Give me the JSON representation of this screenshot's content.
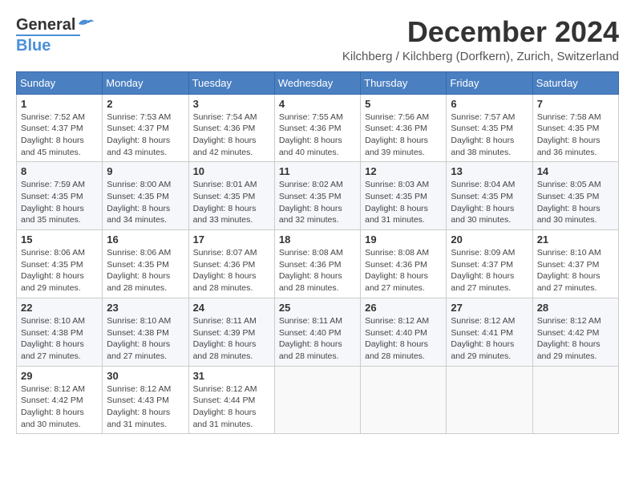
{
  "header": {
    "logo": {
      "line1": "General",
      "line2": "Blue",
      "bird": "🐦"
    },
    "title": "December 2024",
    "location": "Kilchberg / Kilchberg (Dorfkern), Zurich, Switzerland"
  },
  "weekdays": [
    "Sunday",
    "Monday",
    "Tuesday",
    "Wednesday",
    "Thursday",
    "Friday",
    "Saturday"
  ],
  "weeks": [
    [
      {
        "day": "1",
        "sunrise": "7:52 AM",
        "sunset": "4:37 PM",
        "daylight": "8 hours and 45 minutes."
      },
      {
        "day": "2",
        "sunrise": "7:53 AM",
        "sunset": "4:37 PM",
        "daylight": "8 hours and 43 minutes."
      },
      {
        "day": "3",
        "sunrise": "7:54 AM",
        "sunset": "4:36 PM",
        "daylight": "8 hours and 42 minutes."
      },
      {
        "day": "4",
        "sunrise": "7:55 AM",
        "sunset": "4:36 PM",
        "daylight": "8 hours and 40 minutes."
      },
      {
        "day": "5",
        "sunrise": "7:56 AM",
        "sunset": "4:36 PM",
        "daylight": "8 hours and 39 minutes."
      },
      {
        "day": "6",
        "sunrise": "7:57 AM",
        "sunset": "4:35 PM",
        "daylight": "8 hours and 38 minutes."
      },
      {
        "day": "7",
        "sunrise": "7:58 AM",
        "sunset": "4:35 PM",
        "daylight": "8 hours and 36 minutes."
      }
    ],
    [
      {
        "day": "8",
        "sunrise": "7:59 AM",
        "sunset": "4:35 PM",
        "daylight": "8 hours and 35 minutes."
      },
      {
        "day": "9",
        "sunrise": "8:00 AM",
        "sunset": "4:35 PM",
        "daylight": "8 hours and 34 minutes."
      },
      {
        "day": "10",
        "sunrise": "8:01 AM",
        "sunset": "4:35 PM",
        "daylight": "8 hours and 33 minutes."
      },
      {
        "day": "11",
        "sunrise": "8:02 AM",
        "sunset": "4:35 PM",
        "daylight": "8 hours and 32 minutes."
      },
      {
        "day": "12",
        "sunrise": "8:03 AM",
        "sunset": "4:35 PM",
        "daylight": "8 hours and 31 minutes."
      },
      {
        "day": "13",
        "sunrise": "8:04 AM",
        "sunset": "4:35 PM",
        "daylight": "8 hours and 30 minutes."
      },
      {
        "day": "14",
        "sunrise": "8:05 AM",
        "sunset": "4:35 PM",
        "daylight": "8 hours and 30 minutes."
      }
    ],
    [
      {
        "day": "15",
        "sunrise": "8:06 AM",
        "sunset": "4:35 PM",
        "daylight": "8 hours and 29 minutes."
      },
      {
        "day": "16",
        "sunrise": "8:06 AM",
        "sunset": "4:35 PM",
        "daylight": "8 hours and 28 minutes."
      },
      {
        "day": "17",
        "sunrise": "8:07 AM",
        "sunset": "4:36 PM",
        "daylight": "8 hours and 28 minutes."
      },
      {
        "day": "18",
        "sunrise": "8:08 AM",
        "sunset": "4:36 PM",
        "daylight": "8 hours and 28 minutes."
      },
      {
        "day": "19",
        "sunrise": "8:08 AM",
        "sunset": "4:36 PM",
        "daylight": "8 hours and 27 minutes."
      },
      {
        "day": "20",
        "sunrise": "8:09 AM",
        "sunset": "4:37 PM",
        "daylight": "8 hours and 27 minutes."
      },
      {
        "day": "21",
        "sunrise": "8:10 AM",
        "sunset": "4:37 PM",
        "daylight": "8 hours and 27 minutes."
      }
    ],
    [
      {
        "day": "22",
        "sunrise": "8:10 AM",
        "sunset": "4:38 PM",
        "daylight": "8 hours and 27 minutes."
      },
      {
        "day": "23",
        "sunrise": "8:10 AM",
        "sunset": "4:38 PM",
        "daylight": "8 hours and 27 minutes."
      },
      {
        "day": "24",
        "sunrise": "8:11 AM",
        "sunset": "4:39 PM",
        "daylight": "8 hours and 28 minutes."
      },
      {
        "day": "25",
        "sunrise": "8:11 AM",
        "sunset": "4:40 PM",
        "daylight": "8 hours and 28 minutes."
      },
      {
        "day": "26",
        "sunrise": "8:12 AM",
        "sunset": "4:40 PM",
        "daylight": "8 hours and 28 minutes."
      },
      {
        "day": "27",
        "sunrise": "8:12 AM",
        "sunset": "4:41 PM",
        "daylight": "8 hours and 29 minutes."
      },
      {
        "day": "28",
        "sunrise": "8:12 AM",
        "sunset": "4:42 PM",
        "daylight": "8 hours and 29 minutes."
      }
    ],
    [
      {
        "day": "29",
        "sunrise": "8:12 AM",
        "sunset": "4:42 PM",
        "daylight": "8 hours and 30 minutes."
      },
      {
        "day": "30",
        "sunrise": "8:12 AM",
        "sunset": "4:43 PM",
        "daylight": "8 hours and 31 minutes."
      },
      {
        "day": "31",
        "sunrise": "8:12 AM",
        "sunset": "4:44 PM",
        "daylight": "8 hours and 31 minutes."
      },
      null,
      null,
      null,
      null
    ]
  ],
  "labels": {
    "sunrise": "Sunrise:",
    "sunset": "Sunset:",
    "daylight": "Daylight:"
  }
}
